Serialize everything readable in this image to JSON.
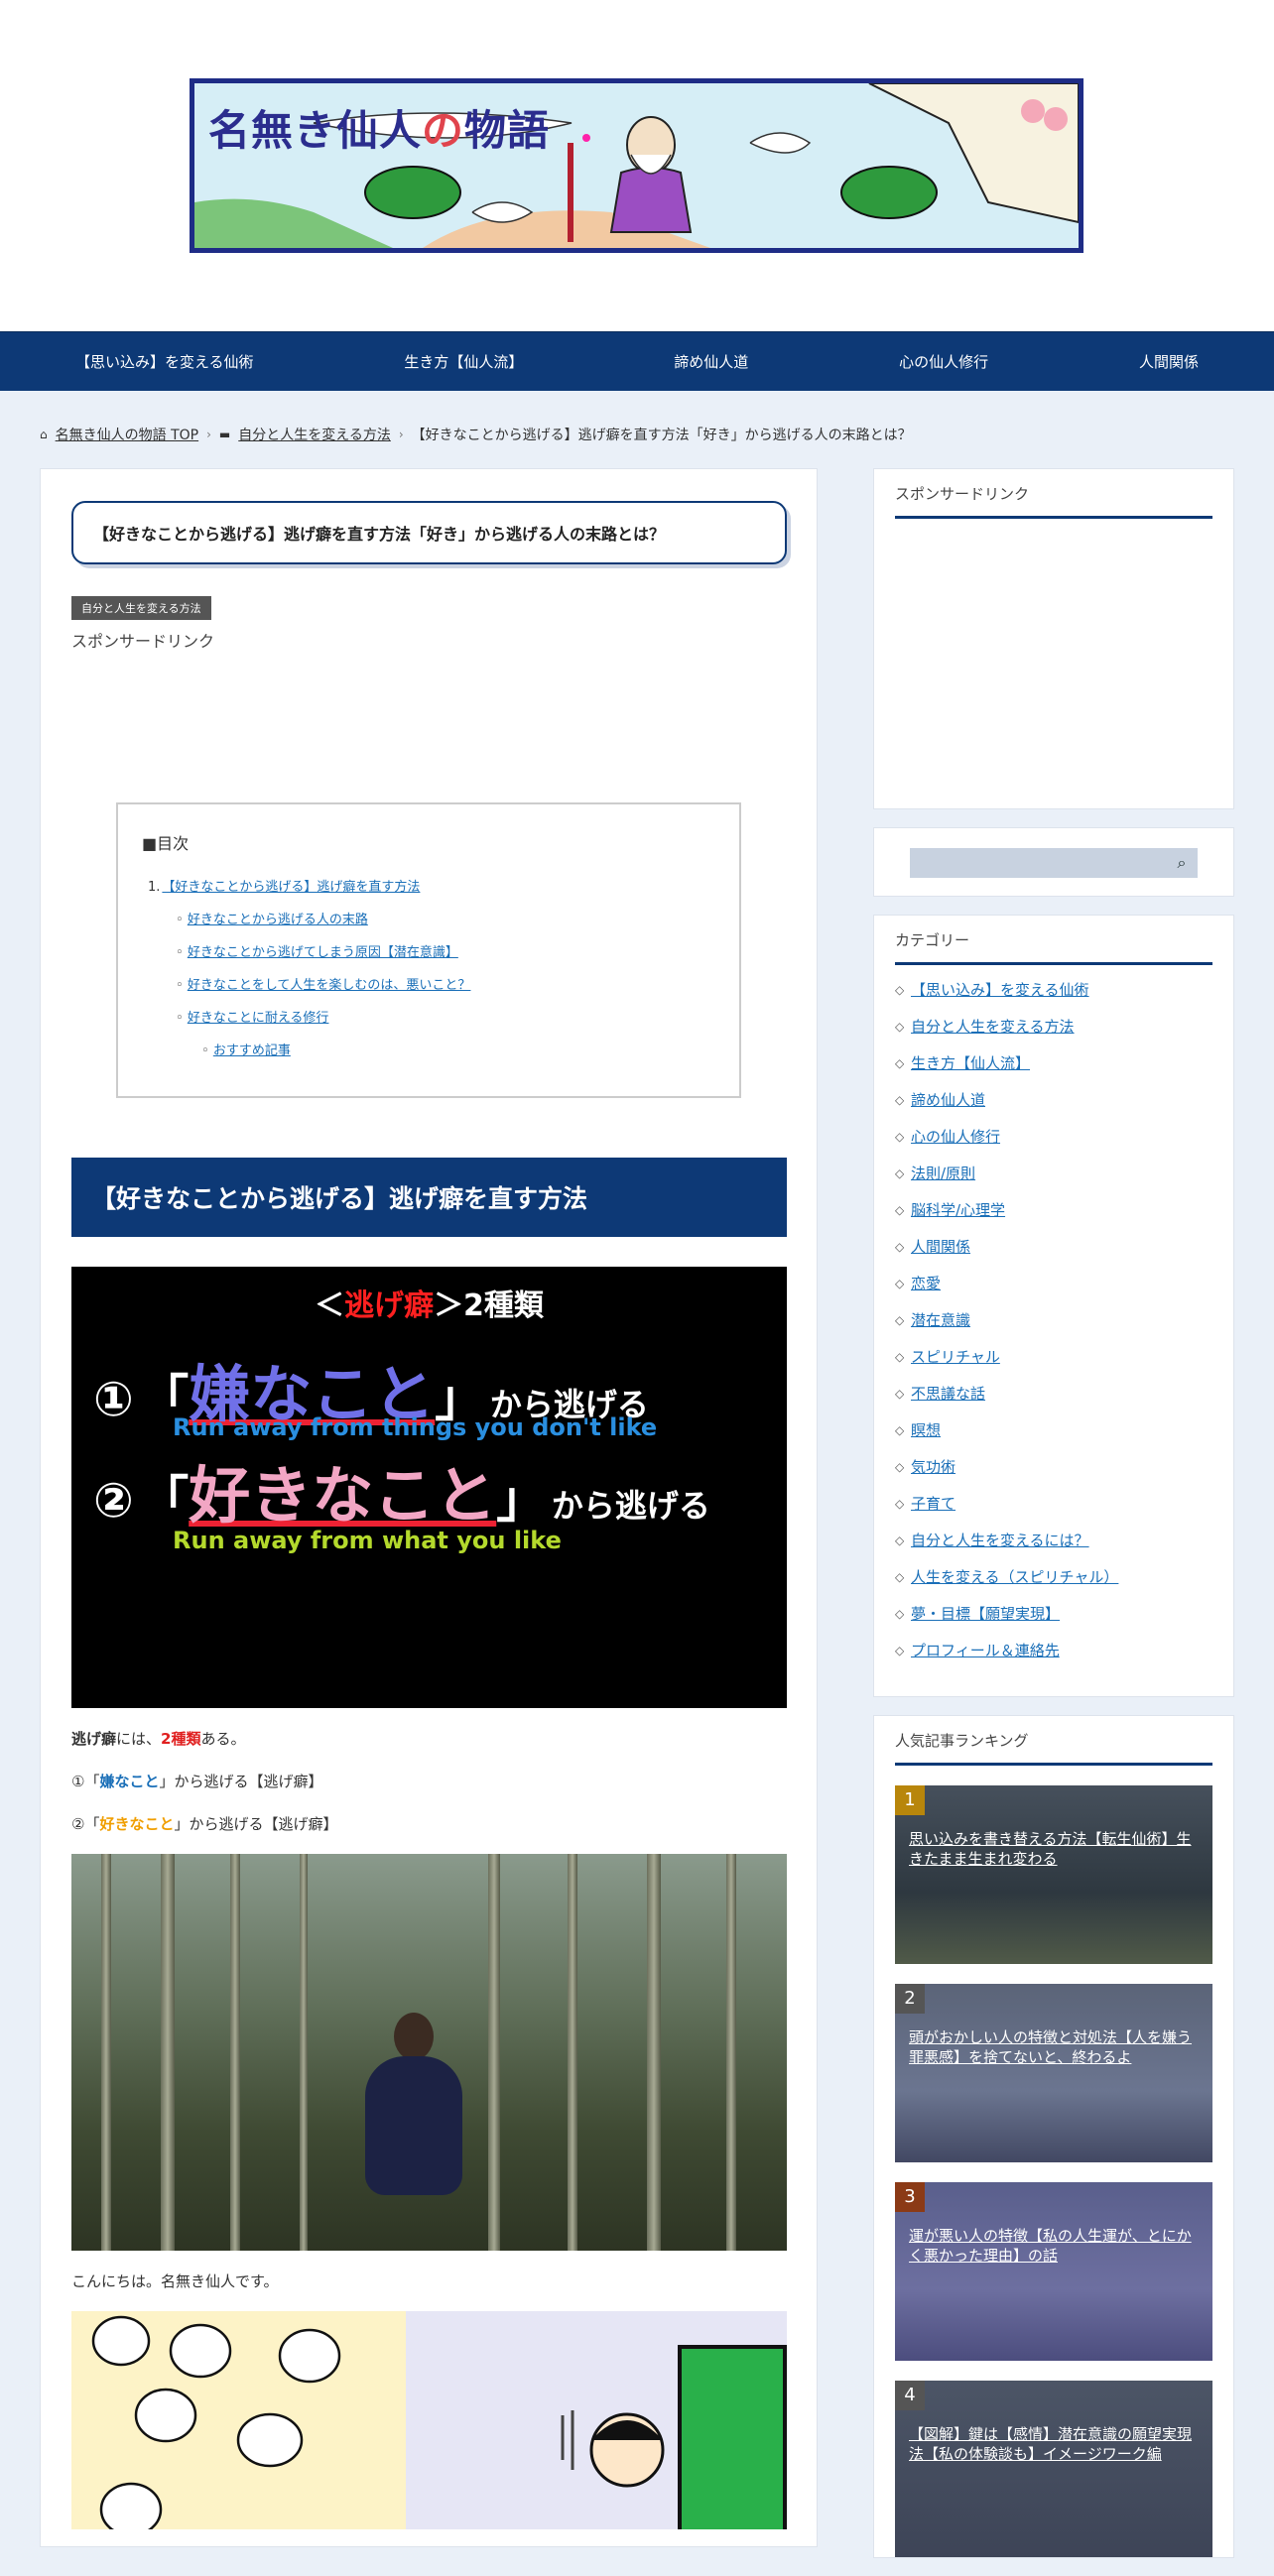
{
  "header": {
    "banner_title_a": "名無き仙人",
    "banner_title_b": "の",
    "banner_title_c": "物語"
  },
  "nav": {
    "items": [
      "【思い込み】を変える仙術",
      "生き方【仙人流】",
      "諦め仙人道",
      "心の仙人修行",
      "人間関係"
    ]
  },
  "breadcrumb": {
    "home": "名無き仙人の物語 TOP",
    "category": "自分と人生を変える方法",
    "current": "【好きなことから逃げる】逃げ癖を直す方法「好き」から逃げる人の末路とは？"
  },
  "article": {
    "title": "【好きなことから逃げる】逃げ癖を直す方法「好き」から逃げる人の末路とは？",
    "category_label": "自分と人生を変える方法",
    "sponsor": "スポンサードリンク",
    "toc": {
      "title": "■目次",
      "num1": "1.",
      "items": [
        "【好きなことから逃げる】逃げ癖を直す方法",
        "好きなことから逃げる人の末路",
        "好きなことから逃げてしまう原因【潜在意識】",
        "好きなことをして人生を楽しむのは、悪いこと？",
        "好きなことに耐える修行",
        "おすすめ記事"
      ]
    },
    "h2": "【好きなことから逃げる】逃げ癖を直す方法",
    "figure": {
      "title_a": "＜",
      "title_b": "逃げ癖",
      "title_c": "＞2種類",
      "row1_num": "①",
      "row1_open": "「",
      "row1_big": "嫌なこと",
      "row1_close": "」",
      "row1_rest": "から逃げる",
      "row1_en": "Run away from things you don't like",
      "row2_num": "②",
      "row2_open": "「",
      "row2_big": "好きなこと",
      "row2_close": "」",
      "row2_rest": "から逃げる",
      "row2_en": "Run away from what you like"
    },
    "para1_a": "逃げ癖",
    "para1_b": "には、",
    "para1_c": "2種類",
    "para1_d": "ある。",
    "para2_a": "①「",
    "para2_b": "嫌なこと",
    "para2_c": "」から逃げる【逃げ癖】",
    "para3_a": "②「",
    "para3_b": "好きなこと",
    "para3_c": "」から逃げる【逃げ癖】",
    "greeting": "こんにちは。名無き仙人です。"
  },
  "sidebar": {
    "sponsor_title": "スポンサードリンク",
    "category_title": "カテゴリー",
    "categories": [
      "【思い込み】を変える仙術",
      "自分と人生を変える方法",
      "生き方【仙人流】",
      "諦め仙人道",
      "心の仙人修行",
      "法則/原則",
      "脳科学/心理学",
      "人間関係",
      "恋愛",
      "潜在意識",
      "スピリチャル",
      "不思議な話",
      "瞑想",
      "気功術",
      "子育て",
      "自分と人生を変えるには？",
      "人生を変える（スピリチャル）",
      "夢・目標【願望実現】",
      "プロフィール＆連絡先"
    ],
    "ranking_title": "人気記事ランキング",
    "ranking": [
      {
        "num": "1",
        "title": "思い込みを書き替える方法【転生仙術】生きたまま生まれ変わる"
      },
      {
        "num": "2",
        "title": "頭がおかしい人の特徴と対処法【人を嫌う罪悪感】を捨てないと、終わるよ"
      },
      {
        "num": "3",
        "title": "運が悪い人の特徴【私の人生運が、とにかく悪かった理由】の話"
      },
      {
        "num": "4",
        "title": "【図解】鍵は【感情】潜在意識の願望実現法【私の体験談も】イメージワーク編"
      }
    ]
  },
  "colors": {
    "nav_bg": "#0d3976",
    "accent_red": "#e02020",
    "link_blue": "#1a6fb8"
  }
}
